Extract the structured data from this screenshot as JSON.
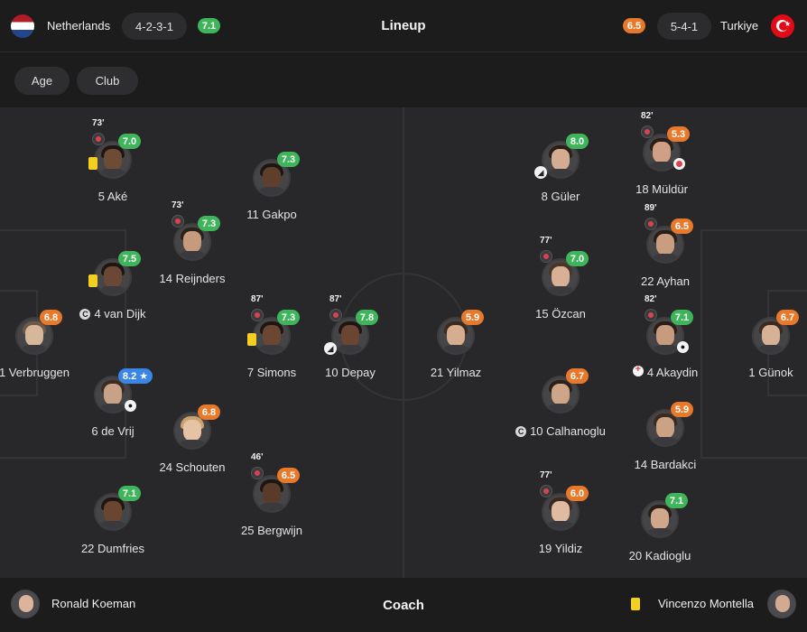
{
  "header": {
    "title": "Lineup",
    "home": {
      "name": "Netherlands",
      "formation": "4-2-3-1",
      "rating": "7.1",
      "flag_icon": "netherlands-flag-icon"
    },
    "away": {
      "name": "Turkiye",
      "formation": "5-4-1",
      "rating": "6.5",
      "flag_icon": "turkey-flag-icon"
    }
  },
  "filters": {
    "age_label": "Age",
    "club_label": "Club"
  },
  "colors": {
    "rating_green": "#3fb55b",
    "rating_orange": "#e8792b",
    "rating_blue": "#3a86e6",
    "yellow_card": "#f3d01f",
    "sub_off": "#d9434f"
  },
  "home_players": [
    {
      "id": "verbruggen",
      "name": "1 Verbruggen",
      "rating": "6.8"
    },
    {
      "id": "dumfries",
      "name": "22 Dumfries",
      "rating": "7.1"
    },
    {
      "id": "devrij",
      "name": "6 de Vrij",
      "rating": "8.2 ★"
    },
    {
      "id": "vandijk",
      "name": "4 van Dijk",
      "rating": "7.5",
      "captain": "C"
    },
    {
      "id": "ake",
      "name": "5 Aké",
      "rating": "7.0",
      "sub_time": "73'"
    },
    {
      "id": "schouten",
      "name": "24 Schouten",
      "rating": "6.8"
    },
    {
      "id": "reijnders",
      "name": "14 Reijnders",
      "rating": "7.3",
      "sub_time": "73'"
    },
    {
      "id": "bergwijn",
      "name": "25 Bergwijn",
      "rating": "6.5",
      "sub_time": "46'"
    },
    {
      "id": "simons",
      "name": "7 Simons",
      "rating": "7.3",
      "sub_time": "87'"
    },
    {
      "id": "gakpo",
      "name": "11 Gakpo",
      "rating": "7.3"
    },
    {
      "id": "depay",
      "name": "10 Depay",
      "rating": "7.8",
      "sub_time": "87'"
    }
  ],
  "away_players": [
    {
      "id": "yilmaz",
      "name": "21 Yilmaz",
      "rating": "5.9"
    },
    {
      "id": "guler",
      "name": "8 Güler",
      "rating": "8.0"
    },
    {
      "id": "ozcan",
      "name": "15 Özcan",
      "rating": "7.0",
      "sub_time": "77'"
    },
    {
      "id": "calhanoglu",
      "name": "10 Calhanoglu",
      "rating": "6.7",
      "captain": "C"
    },
    {
      "id": "yildiz",
      "name": "19 Yildiz",
      "rating": "6.0",
      "sub_time": "77'"
    },
    {
      "id": "muldur",
      "name": "18 Müldür",
      "rating": "5.3",
      "sub_time": "82'"
    },
    {
      "id": "ayhan",
      "name": "22 Ayhan",
      "rating": "6.5",
      "sub_time": "89'"
    },
    {
      "id": "akaydin",
      "name": "4 Akaydin",
      "rating": "7.1",
      "sub_time": "82'"
    },
    {
      "id": "bardakci",
      "name": "14 Bardakci",
      "rating": "5.9"
    },
    {
      "id": "kadioglu",
      "name": "20 Kadioglu",
      "rating": "7.1"
    },
    {
      "id": "gunok",
      "name": "1 Günok",
      "rating": "6.7"
    }
  ],
  "coaches": {
    "title": "Coach",
    "home": "Ronald Koeman",
    "away": "Vincenzo Montella"
  }
}
